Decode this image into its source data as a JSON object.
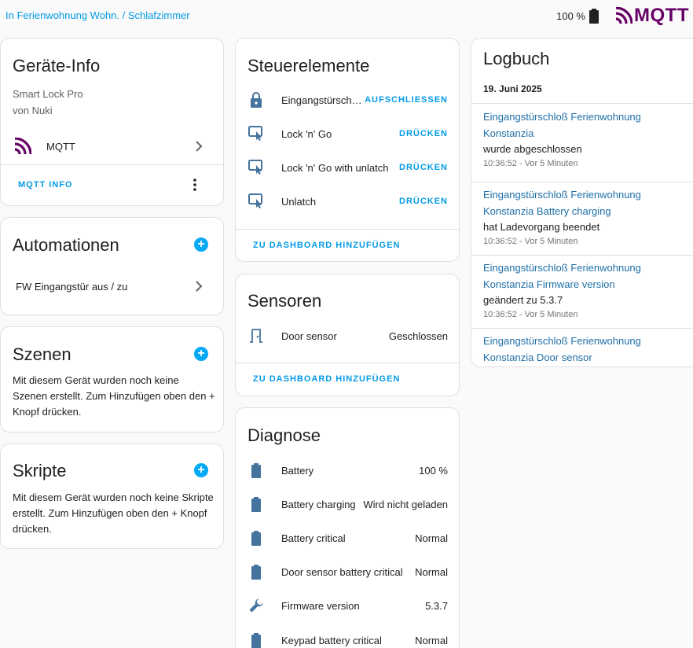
{
  "header": {
    "breadcrumb": "In Ferienwohnung Wohn. / Schlafzimmer",
    "battery": "100 %",
    "brand": "MQTT"
  },
  "device_info": {
    "title": "Geräte-Info",
    "model": "Smart Lock Pro",
    "manufacturer": "von Nuki",
    "integration": "MQTT",
    "info_button": "MQTT INFO"
  },
  "automations": {
    "title": "Automationen",
    "items": [
      {
        "label": "FW Eingangstür aus / zu"
      }
    ]
  },
  "scenes": {
    "title": "Szenen",
    "empty_text": "Mit diesem Gerät wurden noch keine Szenen erstellt. Zum Hinzufügen oben den + Knopf drücken."
  },
  "scripts": {
    "title": "Skripte",
    "empty_text": "Mit diesem Gerät wurden noch keine Skripte erstellt. Zum Hinzufügen oben den + Knopf drücken."
  },
  "controls": {
    "title": "Steuerelemente",
    "items": [
      {
        "icon": "lock-icon",
        "label": "Eingangstürsch…",
        "action": "AUFSCHLIESSEN"
      },
      {
        "icon": "gesture-tap-icon",
        "label": "Lock 'n' Go",
        "action": "DRÜCKEN"
      },
      {
        "icon": "gesture-tap-icon",
        "label": "Lock 'n' Go with unlatch",
        "action": "DRÜCKEN"
      },
      {
        "icon": "gesture-tap-icon",
        "label": "Unlatch",
        "action": "DRÜCKEN"
      }
    ],
    "add_to_dashboard": "ZU DASHBOARD HINZUFÜGEN"
  },
  "sensors": {
    "title": "Sensoren",
    "items": [
      {
        "icon": "door-closed-icon",
        "label": "Door sensor",
        "value": "Geschlossen"
      }
    ],
    "add_to_dashboard": "ZU DASHBOARD HINZUFÜGEN"
  },
  "diagnostics": {
    "title": "Diagnose",
    "items": [
      {
        "icon": "battery-icon",
        "label": "Battery",
        "value": "100 %"
      },
      {
        "icon": "battery-icon",
        "label": "Battery charging",
        "value": "Wird nicht geladen"
      },
      {
        "icon": "battery-icon",
        "label": "Battery critical",
        "value": "Normal"
      },
      {
        "icon": "battery-icon",
        "label": "Door sensor battery critical",
        "value": "Normal"
      },
      {
        "icon": "wrench-icon",
        "label": "Firmware version",
        "value": "5.3.7"
      },
      {
        "icon": "battery-icon",
        "label": "Keypad battery critical",
        "value": "Normal"
      }
    ]
  },
  "logbook": {
    "title": "Logbuch",
    "date": "19. Juni 2025",
    "entries": [
      {
        "entity_line1": "Eingangstürschloß Ferienwohnung",
        "entity_line2": "Konstanzia",
        "message": "wurde abgeschlossen",
        "time": "10:36:52 - Vor 5 Minuten"
      },
      {
        "entity_line1": "Eingangstürschloß Ferienwohnung",
        "entity_line2": "Konstanzia Battery charging",
        "message": "hat Ladevorgang beendet",
        "time": "10:36:52 - Vor 5 Minuten"
      },
      {
        "entity_line1": "Eingangstürschloß Ferienwohnung",
        "entity_line2": "Konstanzia Firmware version",
        "message": "geändert zu 5.3.7",
        "time": "10:36:52 - Vor 5 Minuten"
      },
      {
        "entity_line1": "Eingangstürschloß Ferienwohnung",
        "entity_line2": "Konstanzia Door sensor",
        "message": "",
        "time": ""
      }
    ]
  },
  "colors": {
    "accent": "#03a9f4",
    "link": "#039be5",
    "icon": "#44739e",
    "brand": "#660066"
  }
}
